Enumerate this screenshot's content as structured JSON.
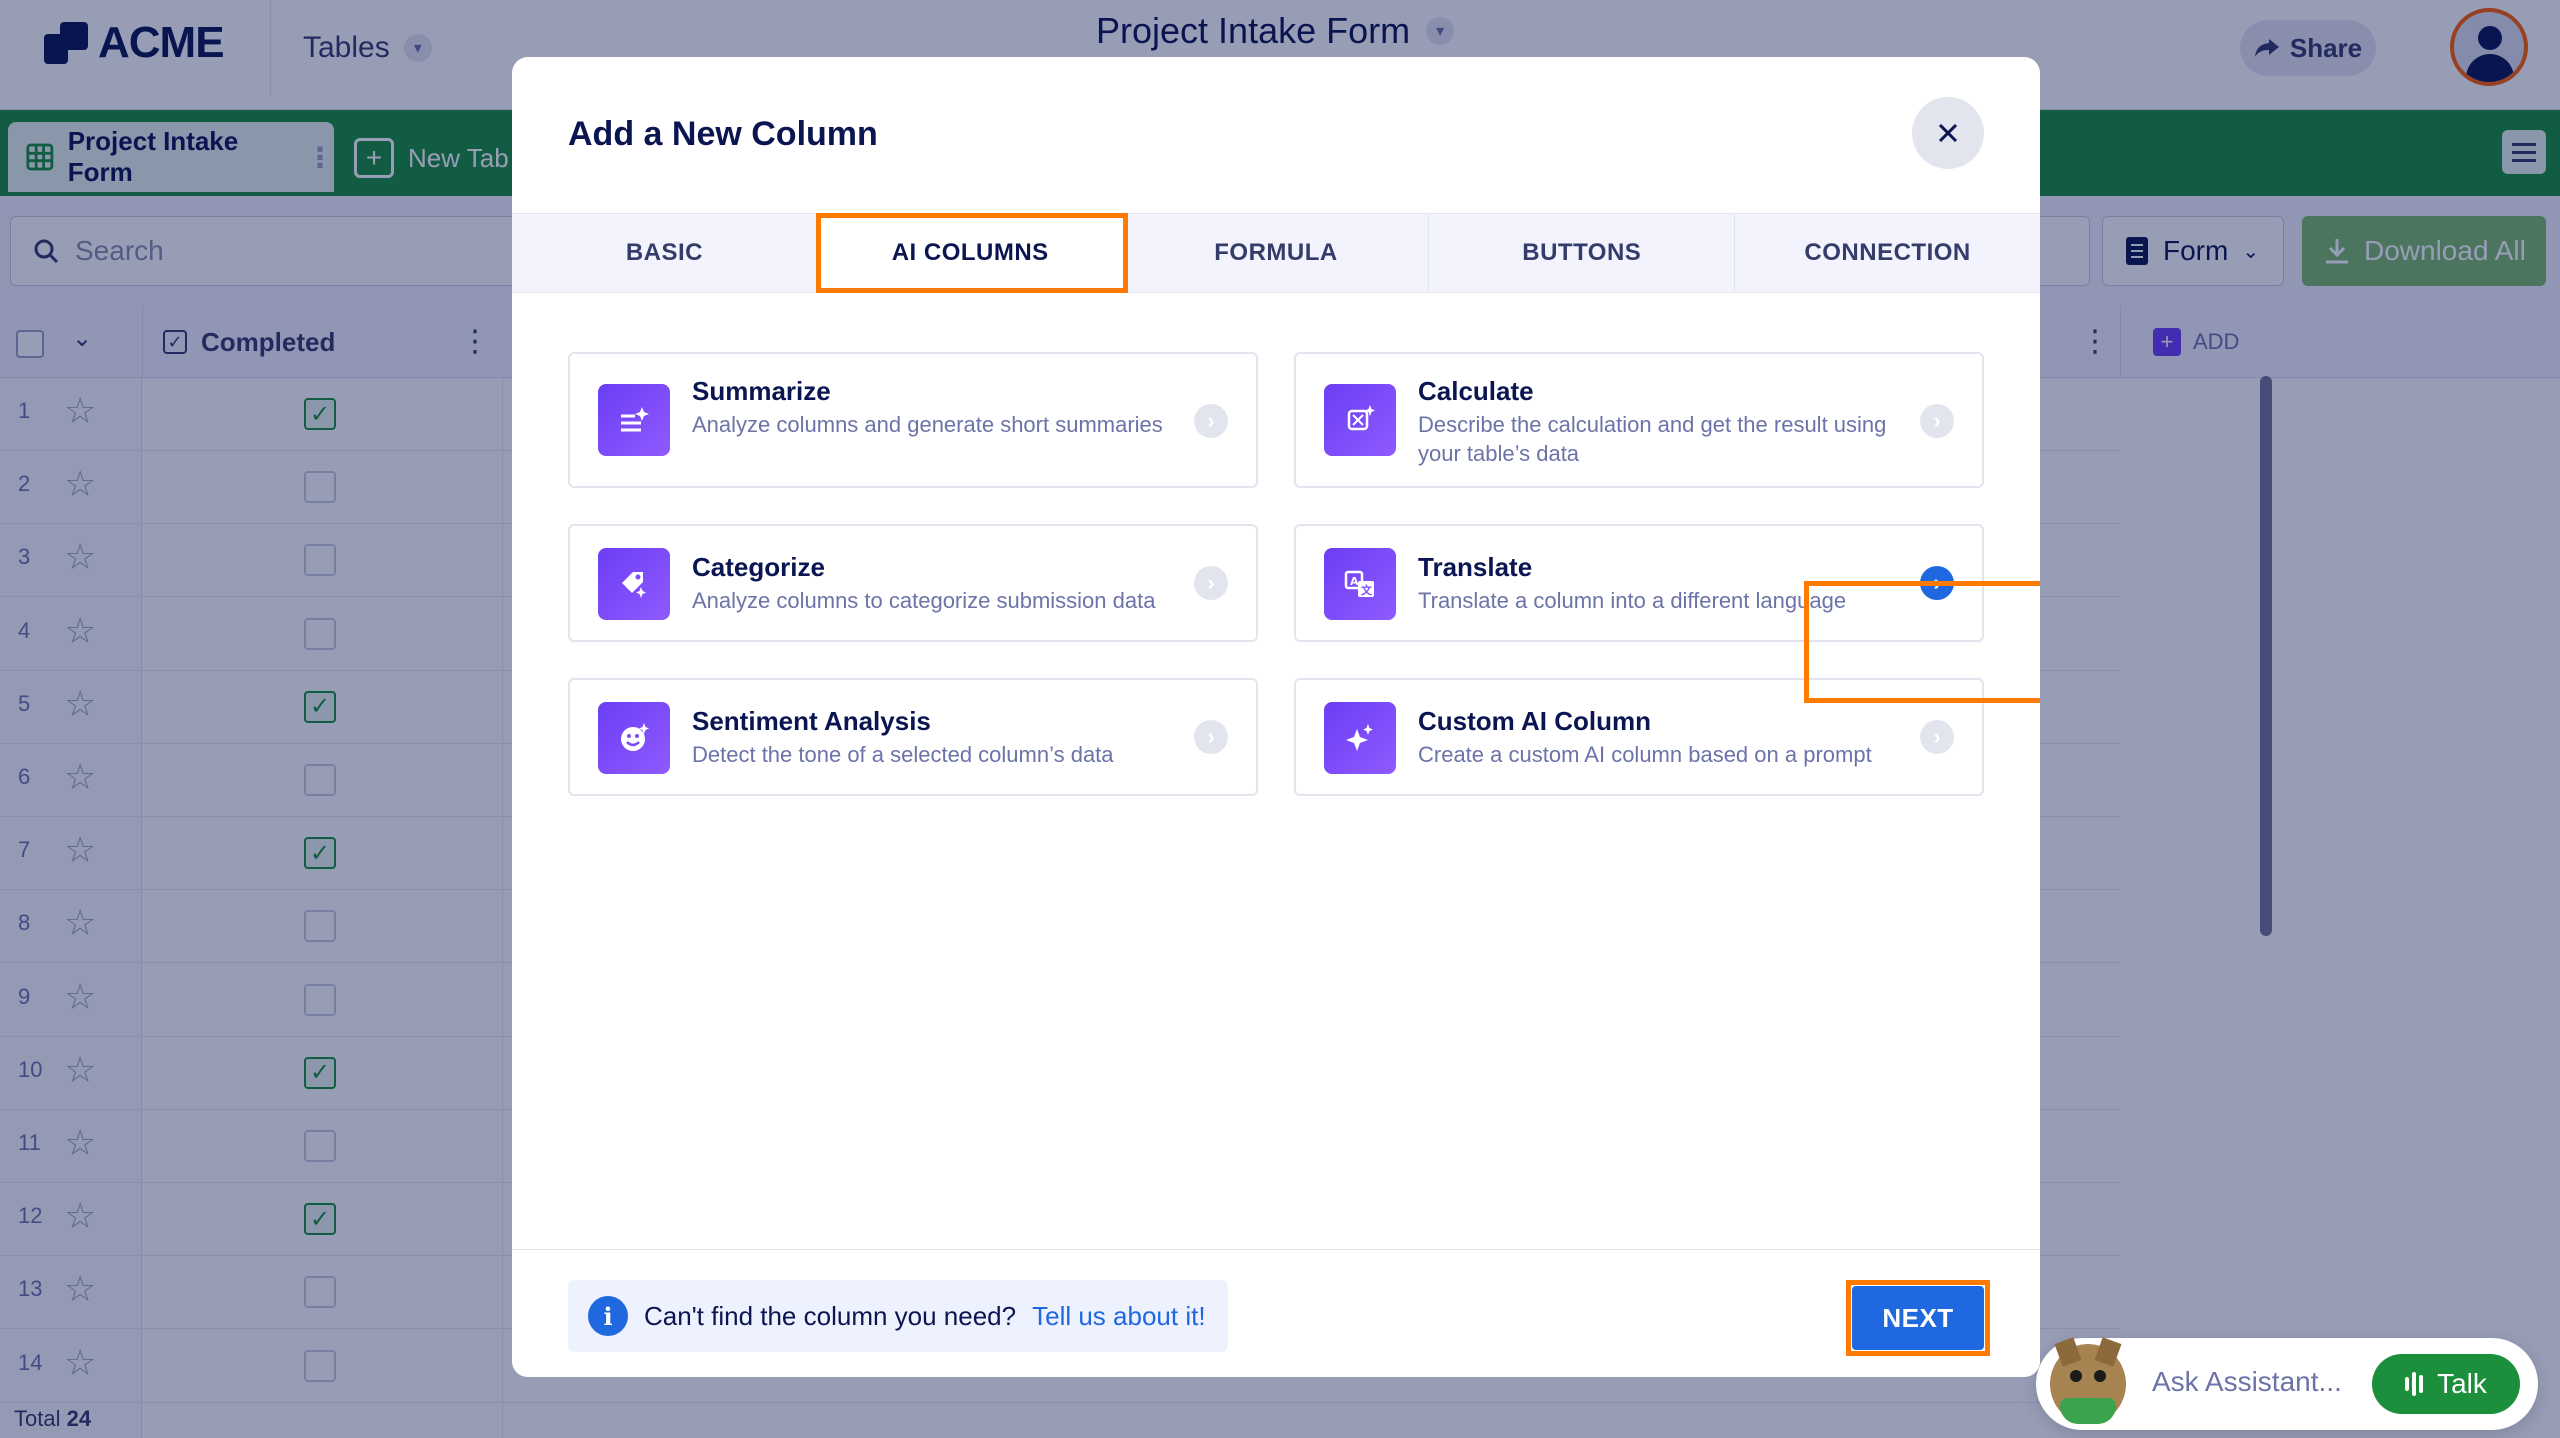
{
  "app": {
    "logo_text": "ACME",
    "tables_menu": "Tables",
    "page_title": "Project Intake Form",
    "share_label": "Share"
  },
  "tabbar": {
    "active_tab": "Project Intake Form",
    "new_tab": "New Tab"
  },
  "toolbar": {
    "search_placeholder": "Search",
    "form_label": "Form",
    "download_label": "Download All"
  },
  "grid": {
    "completed_header": "Completed",
    "add_label": "ADD",
    "rows": [
      {
        "num": "1",
        "checked": true
      },
      {
        "num": "2",
        "checked": false
      },
      {
        "num": "3",
        "checked": false
      },
      {
        "num": "4",
        "checked": false
      },
      {
        "num": "5",
        "checked": true
      },
      {
        "num": "6",
        "checked": false
      },
      {
        "num": "7",
        "checked": true
      },
      {
        "num": "8",
        "checked": false
      },
      {
        "num": "9",
        "checked": false
      },
      {
        "num": "10",
        "checked": true
      },
      {
        "num": "11",
        "checked": false
      },
      {
        "num": "12",
        "checked": true
      },
      {
        "num": "13",
        "checked": false
      },
      {
        "num": "14",
        "checked": false
      }
    ],
    "total_label": "Total",
    "total_value": "24"
  },
  "assistant": {
    "placeholder": "Ask Assistant...",
    "talk_label": "Talk"
  },
  "modal": {
    "title": "Add a New Column",
    "tabs": [
      {
        "label": "BASIC",
        "active": false
      },
      {
        "label": "AI COLUMNS",
        "active": true
      },
      {
        "label": "FORMULA",
        "active": false
      },
      {
        "label": "BUTTONS",
        "active": false
      },
      {
        "label": "CONNECTION",
        "active": false
      }
    ],
    "cards": [
      {
        "title": "Summarize",
        "desc": "Analyze columns and generate short summaries",
        "icon": "summarize-icon",
        "selected": false
      },
      {
        "title": "Calculate",
        "desc": "Describe the calculation and get the result using your table’s data",
        "icon": "calculate-icon",
        "selected": false
      },
      {
        "title": "Categorize",
        "desc": "Analyze columns to categorize submission data",
        "icon": "categorize-icon",
        "selected": false
      },
      {
        "title": "Translate",
        "desc": "Translate a column into a different language",
        "icon": "translate-icon",
        "selected": true
      },
      {
        "title": "Sentiment Analysis",
        "desc": "Detect the tone of a selected column’s data",
        "icon": "sentiment-icon",
        "selected": false
      },
      {
        "title": "Custom AI Column",
        "desc": "Create a custom AI column based on a prompt",
        "icon": "sparkle-icon",
        "selected": false
      }
    ],
    "footer": {
      "info_text": "Can't find the column you need?",
      "info_link": "Tell us about it!",
      "next_label": "NEXT"
    }
  },
  "colors": {
    "accent_blue": "#1f68e0",
    "highlight_orange": "#ff7a00",
    "tabbar_green": "#1b8f3b",
    "ai_purple": "#6b3ef4"
  }
}
